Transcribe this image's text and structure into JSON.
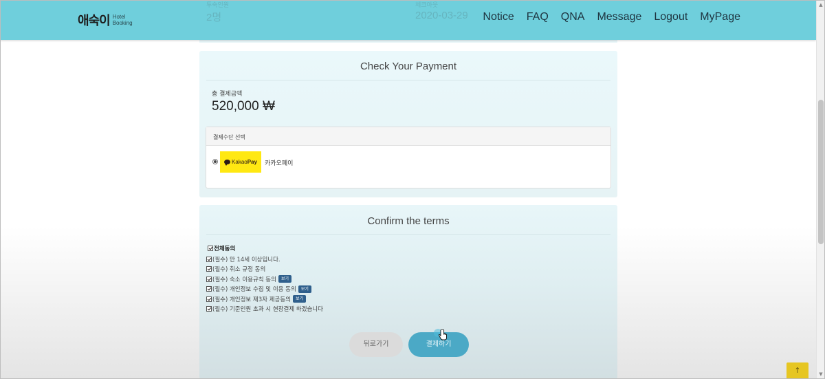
{
  "header": {
    "logo_main": "애숙이",
    "logo_sub_line1": "Hotel",
    "logo_sub_line2": "Booking",
    "nav": [
      "Notice",
      "FAQ",
      "QNA",
      "Message",
      "Logout",
      "MyPage"
    ],
    "ghost_guest_label": "투숙인원",
    "ghost_guest_value": "2명",
    "ghost_date_label": "체크아웃",
    "ghost_date_value": "2020-03-29",
    "bg_color": "#6fcfdc"
  },
  "payment": {
    "title": "Check Your Payment",
    "total_label": "총 결제금액",
    "total_value": "520,000 ₩",
    "method_header": "결제수단 선택",
    "method_logo_text_1": "Kakao",
    "method_logo_text_2": "Pay",
    "method_label": "카카오페이",
    "kakao_color": "#ffe812"
  },
  "terms": {
    "title": "Confirm the terms",
    "agree_all": "전체동의",
    "items": [
      {
        "text": "(필수) 만 14세 이상입니다.",
        "has_view": false
      },
      {
        "text": "(필수) 취소 규정 동의",
        "has_view": false
      },
      {
        "text": "(필수) 숙소 이용규칙 동의",
        "has_view": true
      },
      {
        "text": "(필수) 개인정보 수집 및 이용 동의",
        "has_view": true
      },
      {
        "text": "(필수) 개인정보 제3자 제공동의",
        "has_view": true
      },
      {
        "text": "(필수) 기준인원 초과 시 현장결제 하겠습니다",
        "has_view": false
      }
    ],
    "view_label": "보기",
    "back_button": "뒤로가기",
    "pay_button": "결제하기",
    "pay_color": "#4ba9c6"
  },
  "top_button_icon": "↑"
}
